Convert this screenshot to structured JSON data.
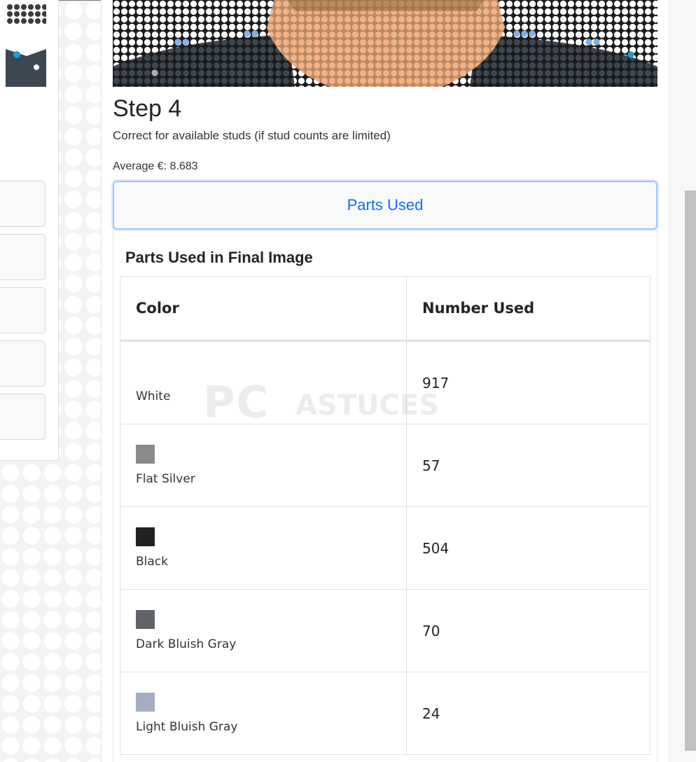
{
  "step": {
    "title": "Step 4",
    "description": "Correct for available studs (if stud counts are limited)",
    "average": "Average €: 8.683"
  },
  "parts_button": {
    "label": "Parts Used"
  },
  "parts_panel": {
    "heading": "Parts Used in Final Image",
    "columns": [
      "Color",
      "Number Used"
    ],
    "rows": [
      {
        "color": "White",
        "swatch": "#ffffff",
        "count": "917"
      },
      {
        "color": "Flat Silver",
        "swatch": "#8a8a8a",
        "count": "57"
      },
      {
        "color": "Black",
        "swatch": "#212121",
        "count": "504"
      },
      {
        "color": "Dark Bluish Gray",
        "swatch": "#5f6368",
        "count": "70"
      },
      {
        "color": "Light Bluish Gray",
        "swatch": "#a6adc2",
        "count": "24"
      }
    ]
  },
  "watermark": {
    "big": "PC",
    "small": "ASTUCES"
  },
  "colors": {
    "accent": "#0d6efd",
    "mosaic_skin": "#f4b183",
    "mosaic_dark": "#3d4752",
    "mosaic_highlight": "#7fb2e5",
    "mosaic_blue": "#1f9bd7"
  }
}
